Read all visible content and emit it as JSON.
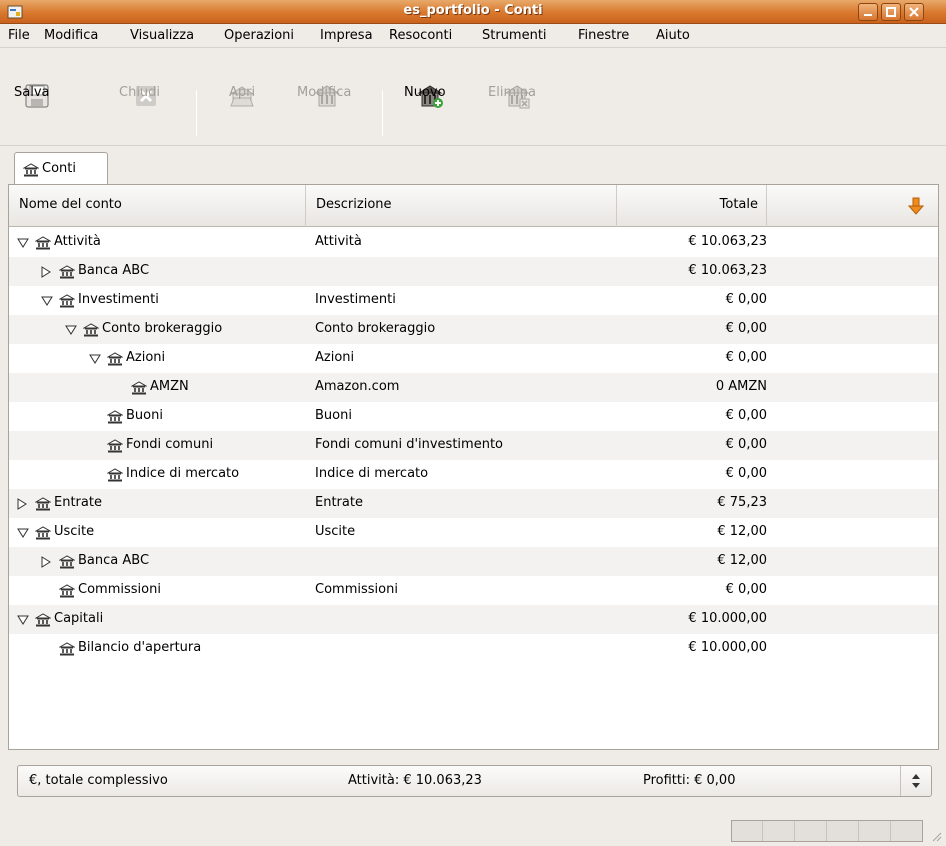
{
  "window": {
    "title": "es_portfolio - Conti"
  },
  "menu": [
    "File",
    "Modifica",
    "Visualizza",
    "Operazioni",
    "Impresa",
    "Resoconti",
    "Strumenti",
    "Finestre",
    "Aiuto"
  ],
  "toolbar": {
    "save": "Salva",
    "close": "Chiudi",
    "open": "Apri",
    "edit": "Modifica",
    "new": "Nuovo",
    "delete": "Elimina"
  },
  "tab": {
    "label": "Conti"
  },
  "columns": {
    "name": "Nome del conto",
    "description": "Descrizione",
    "total": "Totale"
  },
  "accounts": [
    {
      "name": "Attività",
      "description": "Attività",
      "total": "€ 10.063,23",
      "level": 0,
      "expander": "open"
    },
    {
      "name": "Banca ABC",
      "description": "",
      "total": "€ 10.063,23",
      "level": 1,
      "expander": "closed"
    },
    {
      "name": "Investimenti",
      "description": "Investimenti",
      "total": "€ 0,00",
      "level": 1,
      "expander": "open"
    },
    {
      "name": "Conto brokeraggio",
      "description": "Conto brokeraggio",
      "total": "€ 0,00",
      "level": 2,
      "expander": "open"
    },
    {
      "name": "Azioni",
      "description": "Azioni",
      "total": "€ 0,00",
      "level": 3,
      "expander": "open"
    },
    {
      "name": "AMZN",
      "description": "Amazon.com",
      "total": "0 AMZN",
      "level": 4,
      "expander": "none"
    },
    {
      "name": "Buoni",
      "description": "Buoni",
      "total": "€ 0,00",
      "level": 3,
      "expander": "none"
    },
    {
      "name": "Fondi comuni",
      "description": "Fondi comuni d'investimento",
      "total": "€ 0,00",
      "level": 3,
      "expander": "none"
    },
    {
      "name": "Indice di mercato",
      "description": "Indice di mercato",
      "total": "€ 0,00",
      "level": 3,
      "expander": "none"
    },
    {
      "name": "Entrate",
      "description": "Entrate",
      "total": "€ 75,23",
      "level": 0,
      "expander": "closed"
    },
    {
      "name": "Uscite",
      "description": "Uscite",
      "total": "€ 12,00",
      "level": 0,
      "expander": "open"
    },
    {
      "name": "Banca ABC",
      "description": "",
      "total": "€ 12,00",
      "level": 1,
      "expander": "closed"
    },
    {
      "name": "Commissioni",
      "description": "Commissioni",
      "total": "€ 0,00",
      "level": 1,
      "expander": "none"
    },
    {
      "name": "Capitali",
      "description": "",
      "total": "€ 10.000,00",
      "level": 0,
      "expander": "open"
    },
    {
      "name": "Bilancio d'apertura",
      "description": "",
      "total": "€ 10.000,00",
      "level": 1,
      "expander": "none"
    }
  ],
  "summary": {
    "currency": "€, totale complessivo",
    "assets": "Attività: € 10.063,23",
    "profits": "Profitti: € 0,00"
  }
}
